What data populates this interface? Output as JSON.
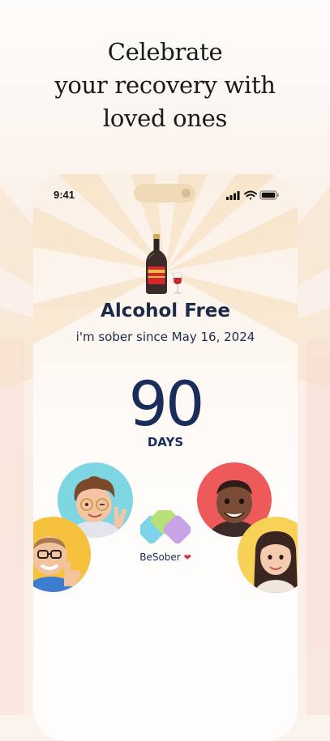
{
  "headline": "Celebrate\nyour recovery with\nloved ones",
  "phone": {
    "status_time": "9:41",
    "status_icons": [
      "signal-icon",
      "wifi-icon",
      "battery-icon"
    ],
    "illustration": "wine-bottle-and-glass-icon",
    "title": "Alcohol Free",
    "subtitle": "i'm sober since May 16, 2024",
    "counter_value": "90",
    "counter_unit": "DAYS",
    "avatars": [
      {
        "name": "avatar-curly-hair-peace-sign",
        "bg": "#7fd6e3"
      },
      {
        "name": "avatar-dark-skin-smile",
        "bg": "#ee5a5a"
      },
      {
        "name": "avatar-glasses-thumbs-up",
        "bg": "#f6c13d"
      },
      {
        "name": "avatar-long-hair-woman",
        "bg": "#f7d257"
      }
    ],
    "brand_label": "BeSober",
    "brand_heart": "❤"
  },
  "colors": {
    "navy": "#1a2c5a",
    "ray": "#f6dfbf",
    "heart": "#d43b46"
  }
}
